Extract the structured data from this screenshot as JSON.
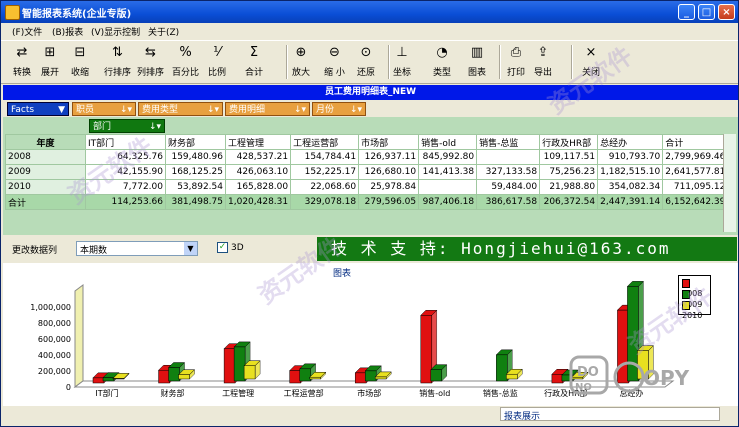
{
  "window": {
    "title": "智能报表系统(企业专版)"
  },
  "menu": [
    "(F)文件",
    "(B)报表",
    "(V)显示控制",
    "关于(Z)"
  ],
  "toolbar": [
    {
      "label": "转换",
      "icon": "convert-icon"
    },
    {
      "label": "展开",
      "icon": "expand-icon"
    },
    {
      "label": "收缩",
      "icon": "collapse-icon"
    },
    {
      "label": "行排序",
      "icon": "row-sort-icon"
    },
    {
      "label": "列排序",
      "icon": "column-sort-icon"
    },
    {
      "label": "百分比",
      "icon": "percent-icon"
    },
    {
      "label": "比例",
      "icon": "ratio-icon"
    },
    {
      "label": "合计",
      "icon": "sum-icon"
    },
    {
      "label": "放大",
      "icon": "zoom-in-icon"
    },
    {
      "label": "缩 小",
      "icon": "zoom-out-icon"
    },
    {
      "label": "还原",
      "icon": "zoom-reset-icon"
    },
    {
      "label": "坐标",
      "icon": "axis-icon"
    },
    {
      "label": "类型",
      "icon": "chart-type-icon"
    },
    {
      "label": "图表",
      "icon": "chart-icon"
    },
    {
      "label": "打印",
      "icon": "print-icon"
    },
    {
      "label": "导出",
      "icon": "export-icon"
    },
    {
      "label": "关闭",
      "icon": "close-icon"
    }
  ],
  "report_title": "员工费用明细表_NEW",
  "fields": {
    "data_field": "Facts",
    "filters": [
      "职员",
      "费用类型",
      "费用明细",
      "月份"
    ],
    "column_field": "部门",
    "row_header": "年度"
  },
  "grid": {
    "columns": [
      "IT部门",
      "财务部",
      "工程管理",
      "工程运营部",
      "市场部",
      "销售-old",
      "销售-总监",
      "行政及HR部",
      "总经办",
      "合计"
    ],
    "rows": [
      {
        "label": "2008",
        "values": [
          "64,325.76",
          "159,480.96",
          "428,537.21",
          "154,784.41",
          "126,937.11",
          "845,992.80",
          "",
          "109,117.51",
          "910,793.70",
          "2,799,969.46"
        ]
      },
      {
        "label": "2009",
        "values": [
          "42,155.90",
          "168,125.25",
          "426,063.10",
          "152,225.17",
          "126,680.10",
          "141,413.38",
          "327,133.58",
          "75,256.23",
          "1,182,515.10",
          "2,641,577.81"
        ]
      },
      {
        "label": "2010",
        "values": [
          "7,772.00",
          "53,892.54",
          "165,828.00",
          "22,068.60",
          "25,978.84",
          "",
          "59,484.00",
          "21,988.80",
          "354,082.34",
          "711,095.12"
        ]
      },
      {
        "label": "合计",
        "values": [
          "114,253.66",
          "381,498.75",
          "1,020,428.31",
          "329,078.18",
          "279,596.05",
          "987,406.18",
          "386,617.58",
          "206,372.54",
          "2,447,391.14",
          "6,152,642.39"
        ]
      }
    ]
  },
  "controls": {
    "change_series_label": "更改数据列",
    "series_select": "本期数",
    "three_d_label": "3D",
    "three_d_checked": true
  },
  "banner_text": "技 术 支 持:  Hongjiehui@163.com",
  "chart_data": {
    "type": "bar",
    "title": "图表",
    "categories": [
      "IT部门",
      "财务部",
      "工程管理",
      "工程运营部",
      "市场部",
      "销售-old",
      "销售-总监",
      "行政及HR部",
      "总经办"
    ],
    "series": [
      {
        "name": "2008",
        "values": [
          64325.76,
          159480.96,
          428537.21,
          154784.41,
          126937.11,
          845992.8,
          0,
          109117.51,
          910793.7
        ]
      },
      {
        "name": "2009",
        "values": [
          42155.9,
          168125.25,
          426063.1,
          152225.17,
          126680.1,
          141413.38,
          327133.58,
          75256.23,
          1182515.1
        ]
      },
      {
        "name": "2010",
        "values": [
          7772.0,
          53892.54,
          165828.0,
          22068.6,
          25978.84,
          0,
          59484.0,
          21988.8,
          354082.34
        ]
      }
    ],
    "yticks": [
      "1,000,000",
      "800,000",
      "600,000",
      "400,000",
      "200,000",
      "0"
    ],
    "ylim": [
      0,
      1200000
    ],
    "legend_position": "right",
    "colors": {
      "2008": "#E01010",
      "2009": "#108010",
      "2010": "#E8E020"
    }
  },
  "status": {
    "tab_label": "报表展示"
  },
  "watermark_text": "资元软件",
  "copy_badge": "DO NO COPY"
}
